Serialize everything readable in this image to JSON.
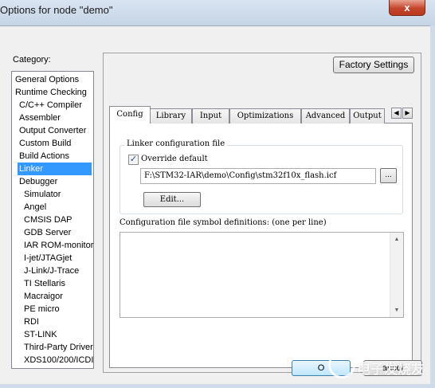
{
  "window": {
    "title": "Options for node \"demo\"",
    "close_glyph": "x"
  },
  "category": {
    "label": "Category:",
    "items": [
      {
        "label": "General Options",
        "indent": 0
      },
      {
        "label": "Runtime Checking",
        "indent": 0
      },
      {
        "label": "C/C++ Compiler",
        "indent": 1
      },
      {
        "label": "Assembler",
        "indent": 1
      },
      {
        "label": "Output Converter",
        "indent": 1
      },
      {
        "label": "Custom Build",
        "indent": 1
      },
      {
        "label": "Build Actions",
        "indent": 1
      },
      {
        "label": "Linker",
        "indent": 1,
        "selected": true
      },
      {
        "label": "Debugger",
        "indent": 1
      },
      {
        "label": "Simulator",
        "indent": 2
      },
      {
        "label": "Angel",
        "indent": 2
      },
      {
        "label": "CMSIS DAP",
        "indent": 2
      },
      {
        "label": "GDB Server",
        "indent": 2
      },
      {
        "label": "IAR ROM-monitor",
        "indent": 2
      },
      {
        "label": "I-jet/JTAGjet",
        "indent": 2
      },
      {
        "label": "J-Link/J-Trace",
        "indent": 2
      },
      {
        "label": "TI Stellaris",
        "indent": 2
      },
      {
        "label": "Macraigor",
        "indent": 2
      },
      {
        "label": "PE micro",
        "indent": 2
      },
      {
        "label": "RDI",
        "indent": 2
      },
      {
        "label": "ST-LINK",
        "indent": 2
      },
      {
        "label": "Third-Party Driver",
        "indent": 2
      },
      {
        "label": "XDS100/200/ICDI",
        "indent": 2
      }
    ]
  },
  "factory_settings_label": "Factory Settings",
  "tabs": [
    {
      "label": "Config",
      "active": true
    },
    {
      "label": "Library"
    },
    {
      "label": "Input"
    },
    {
      "label": "Optimizations"
    },
    {
      "label": "Advanced"
    },
    {
      "label": "Output"
    }
  ],
  "tab_arrows": {
    "left": "◀",
    "right": "▶"
  },
  "config": {
    "group_label": "Linker configuration file",
    "override_label": "Override default",
    "override_checked": true,
    "check_glyph": "✓",
    "path_value": "F:\\STM32-IAR\\demo\\Config\\stm32f10x_flash.icf",
    "browse_label": "...",
    "edit_label": "Edit...",
    "symdef_label": "Configuration file symbol definitions: (one per line)"
  },
  "scroll": {
    "up": "▲",
    "down": "▼"
  },
  "footer": {
    "ok_label": "O",
    "cancel_label": "ancel"
  },
  "watermark": {
    "text": "电子发烧友"
  },
  "colors": {
    "selection": "#3399ff",
    "close_button": "#c6452c",
    "frame": "#cfdbe9"
  }
}
